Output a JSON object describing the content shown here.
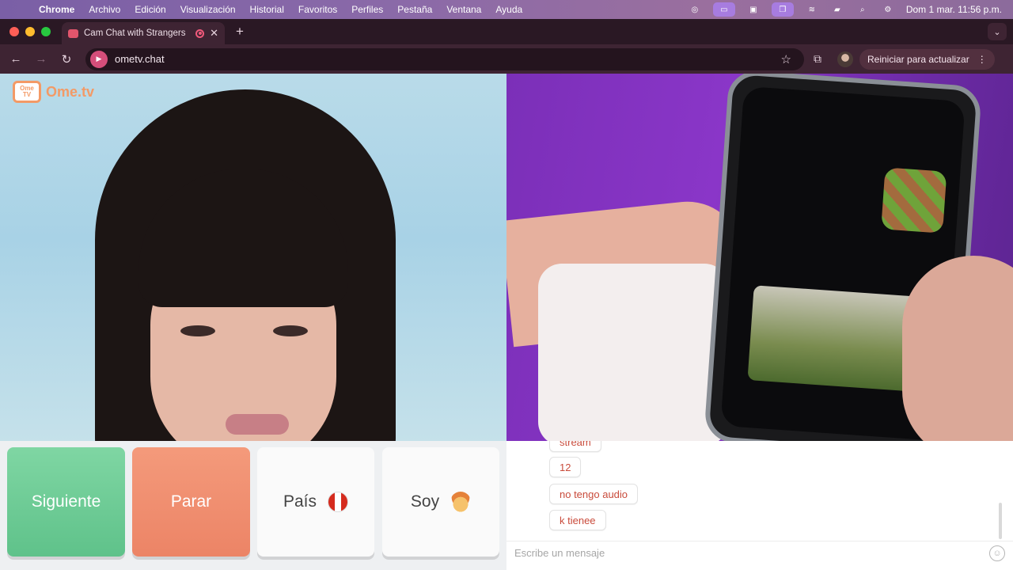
{
  "menubar": {
    "apple": "",
    "items": [
      "Chrome",
      "Archivo",
      "Edición",
      "Visualización",
      "Historial",
      "Favoritos",
      "Perfiles",
      "Pestaña",
      "Ventana",
      "Ayuda"
    ],
    "clock": "Dom 1 mar.  11:56 p.m."
  },
  "tab": {
    "title": "Cam Chat with Strangers",
    "close": "✕",
    "new_tab": "+"
  },
  "tab_menu": "⌄",
  "toolbar": {
    "back": "←",
    "forward": "→",
    "reload": "↻",
    "url": "ometv.chat",
    "star": "☆",
    "update_label": "Reiniciar para actualizar",
    "update_menu": "⋮"
  },
  "logo": {
    "badge_line1": "Ome",
    "badge_line2": "TV",
    "brand": "Ome.tv"
  },
  "buttons": {
    "next": "Siguiente",
    "stop": "Parar",
    "country": "País",
    "gender": "Soy"
  },
  "chat": {
    "messages": [
      "stream",
      "12",
      "no tengo audio",
      "k tienee"
    ],
    "placeholder": "Escribe un mensaje",
    "emoji": "☺"
  },
  "colors": {
    "next": "#6cc994",
    "stop": "#ef8c6d",
    "chat_text": "#c94b3b",
    "brand": "#f39a66"
  }
}
